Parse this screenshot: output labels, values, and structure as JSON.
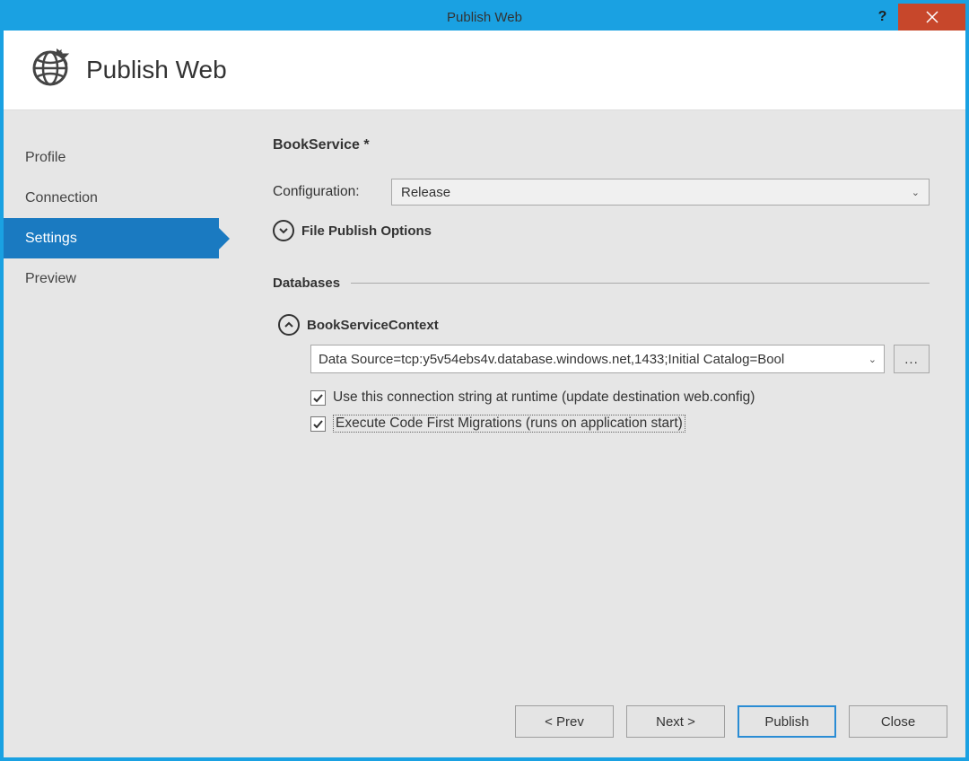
{
  "window": {
    "title": "Publish Web"
  },
  "header": {
    "title": "Publish Web"
  },
  "sidebar": {
    "items": [
      {
        "label": "Profile"
      },
      {
        "label": "Connection"
      },
      {
        "label": "Settings"
      },
      {
        "label": "Preview"
      }
    ],
    "active_index": 2
  },
  "main": {
    "profile_title": "BookService *",
    "configuration": {
      "label": "Configuration:",
      "value": "Release"
    },
    "file_publish_options": {
      "label": "File Publish Options",
      "expanded": false
    },
    "databases_section_title": "Databases",
    "db": {
      "name": "BookServiceContext",
      "expanded": true,
      "connection_string": "Data Source=tcp:y5v54ebs4v.database.windows.net,1433;Initial Catalog=Bool",
      "browse_label": "...",
      "use_connection_string": {
        "label": "Use this connection string at runtime (update destination web.config)",
        "checked": true
      },
      "execute_migrations": {
        "label": "Execute Code First Migrations (runs on application start)",
        "checked": true
      }
    }
  },
  "footer": {
    "prev": "< Prev",
    "next": "Next >",
    "publish": "Publish",
    "close": "Close"
  }
}
